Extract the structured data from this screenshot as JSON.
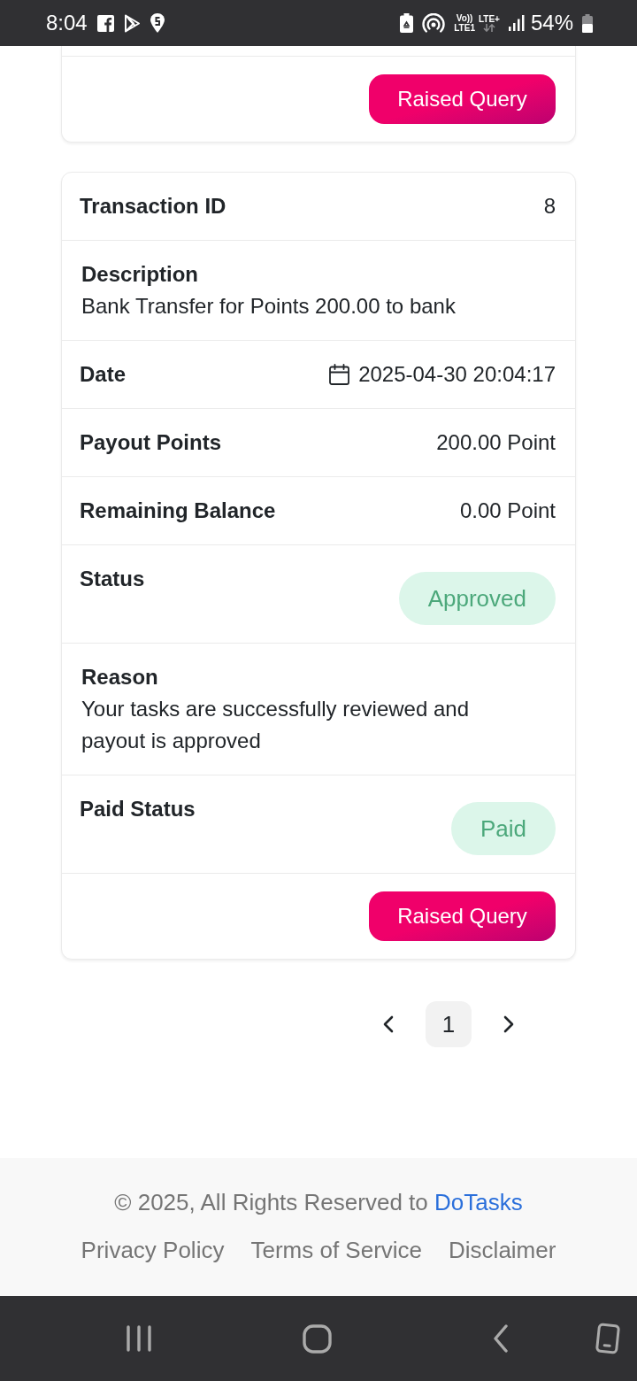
{
  "status_bar": {
    "time": "8:04",
    "volte": "Vo))",
    "sim": "LTE1",
    "network": "LTE+",
    "battery": "54%"
  },
  "previous_card": {
    "button": "Raised Query"
  },
  "transaction": {
    "rows": [
      {
        "kind": "pair",
        "label": "Transaction ID",
        "value": "8"
      },
      {
        "kind": "stacked",
        "label": "Description",
        "value": "Bank Transfer for Points 200.00 to bank"
      },
      {
        "kind": "date",
        "label": "Date",
        "value": "2025-04-30 20:04:17"
      },
      {
        "kind": "pair",
        "label": "Payout Points",
        "value": "200.00 Point"
      },
      {
        "kind": "pair",
        "label": "Remaining Balance",
        "value": "0.00 Point"
      },
      {
        "kind": "badge",
        "label": "Status",
        "value": "Approved"
      },
      {
        "kind": "stacked",
        "label": "Reason",
        "value": "Your tasks are successfully reviewed and payout is approved"
      },
      {
        "kind": "badge",
        "label": "Paid Status",
        "value": "Paid"
      }
    ],
    "button": "Raised Query"
  },
  "pagination": {
    "pages": [
      {
        "label": "1",
        "selected": true
      }
    ]
  },
  "footer": {
    "copyright": "© 2025, All Rights Reserved to",
    "brand_link": "DoTasks",
    "links": [
      "Privacy Policy",
      "Terms of Service",
      "Disclaimer"
    ]
  }
}
